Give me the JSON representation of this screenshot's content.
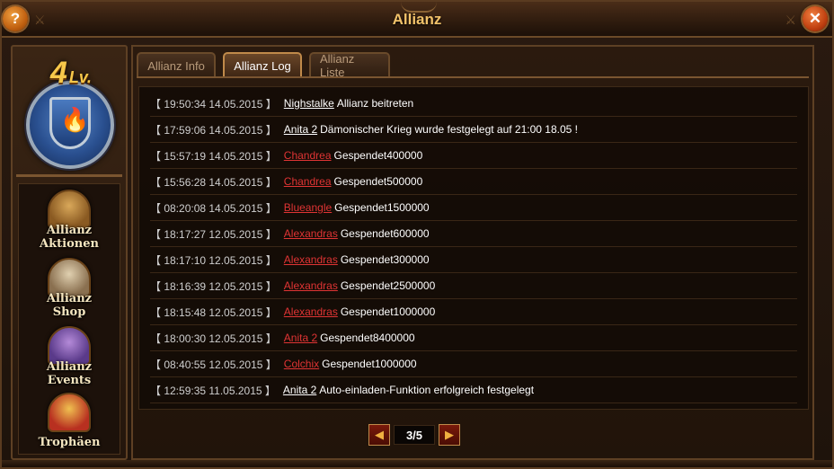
{
  "window": {
    "title": "Allianz"
  },
  "alliance": {
    "level_number": "4",
    "level_suffix": "Lv."
  },
  "sidebar": {
    "items": [
      {
        "label_line1": "Allianz",
        "label_line2": "Aktionen",
        "icon": "castle-icon"
      },
      {
        "label_line1": "Allianz",
        "label_line2": "Shop",
        "icon": "shop-icon"
      },
      {
        "label_line1": "Allianz",
        "label_line2": "Events",
        "icon": "treasure-chest-icon"
      },
      {
        "label_line1": "Trophäen",
        "label_line2": "",
        "icon": "trophy-icon"
      }
    ]
  },
  "tabs": [
    {
      "label": "Allianz Info",
      "active": false
    },
    {
      "label": "Allianz Log",
      "active": true
    },
    {
      "label": "Allianz Liste",
      "active": false
    }
  ],
  "log": [
    {
      "time": "【 19:50:34 14.05.2015 】",
      "user": "Nighstalke",
      "user_color": "white",
      "message": "Allianz beitreten"
    },
    {
      "time": "【 17:59:06 14.05.2015 】",
      "user": "Anita 2",
      "user_color": "white",
      "message": "Dämonischer Krieg wurde festgelegt auf 21:00 18.05 !"
    },
    {
      "time": "【 15:57:19 14.05.2015 】",
      "user": "Chandrea",
      "user_color": "red",
      "message": "Gespendet400000"
    },
    {
      "time": "【 15:56:28 14.05.2015 】",
      "user": "Chandrea",
      "user_color": "red",
      "message": "Gespendet500000"
    },
    {
      "time": "【 08:20:08 14.05.2015 】",
      "user": "Blueangle",
      "user_color": "red",
      "message": "Gespendet1500000"
    },
    {
      "time": "【 18:17:27 12.05.2015 】",
      "user": "Alexandras",
      "user_color": "red",
      "message": "Gespendet600000"
    },
    {
      "time": "【 18:17:10 12.05.2015 】",
      "user": "Alexandras",
      "user_color": "red",
      "message": "Gespendet300000"
    },
    {
      "time": "【 18:16:39 12.05.2015 】",
      "user": "Alexandras",
      "user_color": "red",
      "message": "Gespendet2500000"
    },
    {
      "time": "【 18:15:48 12.05.2015 】",
      "user": "Alexandras",
      "user_color": "red",
      "message": "Gespendet1000000"
    },
    {
      "time": "【 18:00:30 12.05.2015 】",
      "user": "Anita 2",
      "user_color": "red",
      "message": "Gespendet8400000"
    },
    {
      "time": "【 08:40:55 12.05.2015 】",
      "user": "Colchix",
      "user_color": "red",
      "message": "Gespendet1000000"
    },
    {
      "time": "【 12:59:35 11.05.2015 】",
      "user": "Anita 2",
      "user_color": "white",
      "message": "Auto-einladen-Funktion erfolgreich festgelegt"
    }
  ],
  "pager": {
    "display": "3/5",
    "prev_icon": "arrow-left-icon",
    "next_icon": "arrow-right-icon"
  },
  "colors": {
    "title": "#f2c26a",
    "user_red": "#e03434",
    "accent_border": "#c08a4a"
  }
}
